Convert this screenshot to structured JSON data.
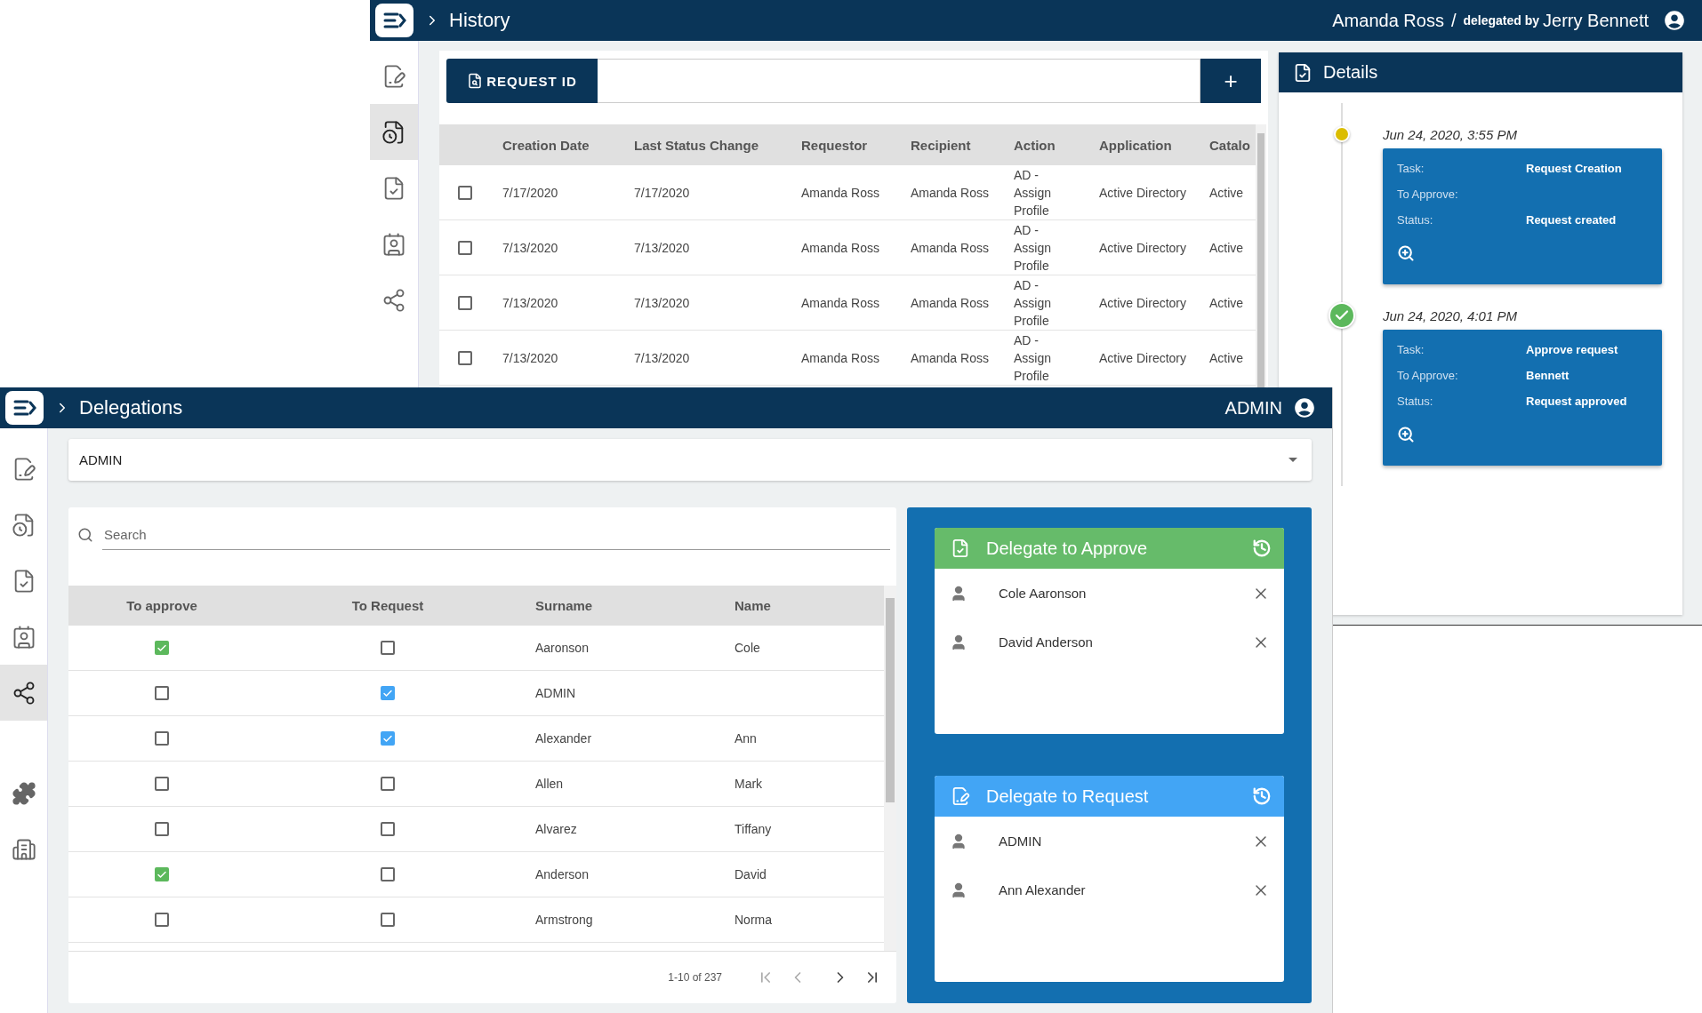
{
  "history_window": {
    "title": "History",
    "user": "Amanda Ross",
    "separator": "/",
    "delegated_label": "delegated by",
    "delegator": "Jerry Bennett",
    "sidebar": [
      {
        "kind": "edit",
        "selected": false
      },
      {
        "kind": "history",
        "selected": true
      },
      {
        "kind": "approve",
        "selected": false
      },
      {
        "kind": "contacts",
        "selected": false
      },
      {
        "kind": "share",
        "selected": false
      }
    ],
    "search_button": "REQUEST ID",
    "add_button": "+",
    "table": {
      "columns": [
        "Creation Date",
        "Last Status Change",
        "Requestor",
        "Recipient",
        "Action",
        "Application",
        "Catalo"
      ],
      "rows": [
        {
          "checked": false,
          "cells": [
            "7/17/2020",
            "7/17/2020",
            "Amanda Ross",
            "Amanda Ross",
            "AD - Assign Profile",
            "Active Directory",
            "Active"
          ]
        },
        {
          "checked": false,
          "cells": [
            "7/13/2020",
            "7/13/2020",
            "Amanda Ross",
            "Amanda Ross",
            "AD - Assign Profile",
            "Active Directory",
            "Active"
          ]
        },
        {
          "checked": false,
          "cells": [
            "7/13/2020",
            "7/13/2020",
            "Amanda Ross",
            "Amanda Ross",
            "AD - Assign Profile",
            "Active Directory",
            "Active"
          ]
        },
        {
          "checked": false,
          "cells": [
            "7/13/2020",
            "7/13/2020",
            "Amanda Ross",
            "Amanda Ross",
            "AD - Assign Profile",
            "Active Directory",
            "Active"
          ]
        }
      ]
    },
    "details": {
      "title": "Details",
      "events": [
        {
          "date": "Jun 24, 2020, 3:55 PM",
          "completed": false,
          "fields": [
            {
              "label": "Task:",
              "value": "Request Creation"
            },
            {
              "label": "To Approve:"
            },
            {
              "label": "Status:",
              "value": "Request created"
            }
          ]
        },
        {
          "date": "Jun 24, 2020, 4:01 PM",
          "completed": true,
          "fields": [
            {
              "label": "Task:",
              "value": "Approve request"
            },
            {
              "label": "To Approve:",
              "value": "Bennett"
            },
            {
              "label": "Status:",
              "value": "Request approved"
            }
          ]
        }
      ]
    }
  },
  "delegations_window": {
    "title": "Delegations",
    "user": "ADMIN",
    "sidebar": [
      {
        "kind": "edit",
        "selected": false
      },
      {
        "kind": "history",
        "selected": false
      },
      {
        "kind": "approve",
        "selected": false
      },
      {
        "kind": "contacts",
        "selected": false
      },
      {
        "kind": "share",
        "selected": true
      }
    ],
    "sidebar_bottom": [
      {
        "kind": "puzzle",
        "selected": false
      },
      {
        "kind": "building",
        "selected": false
      }
    ],
    "user_select": {
      "value": "ADMIN"
    },
    "search": {
      "placeholder": "Search"
    },
    "table": {
      "columns": [
        "To approve",
        "To Request",
        "Surname",
        "Name"
      ],
      "rows": [
        {
          "to_approve": true,
          "to_request": false,
          "surname": "Aaronson",
          "name": "Cole"
        },
        {
          "to_approve": false,
          "to_request": true,
          "surname": "ADMIN"
        },
        {
          "to_approve": false,
          "to_request": true,
          "surname": "Alexander",
          "name": "Ann"
        },
        {
          "to_approve": false,
          "to_request": false,
          "surname": "Allen",
          "name": "Mark"
        },
        {
          "to_approve": false,
          "to_request": false,
          "surname": "Alvarez",
          "name": "Tiffany"
        },
        {
          "to_approve": true,
          "to_request": false,
          "surname": "Anderson",
          "name": "David"
        },
        {
          "to_approve": false,
          "to_request": false,
          "surname": "Armstrong",
          "name": "Norma"
        }
      ]
    },
    "pagination": {
      "range": "1-10 of 237"
    },
    "delegate_cards": [
      {
        "kind": "approve",
        "title": "Delegate to Approve",
        "people": [
          "Cole Aaronson",
          "David Anderson"
        ]
      },
      {
        "kind": "request",
        "title": "Delegate to Request",
        "people": [
          "ADMIN",
          "Ann Alexander"
        ]
      }
    ]
  }
}
